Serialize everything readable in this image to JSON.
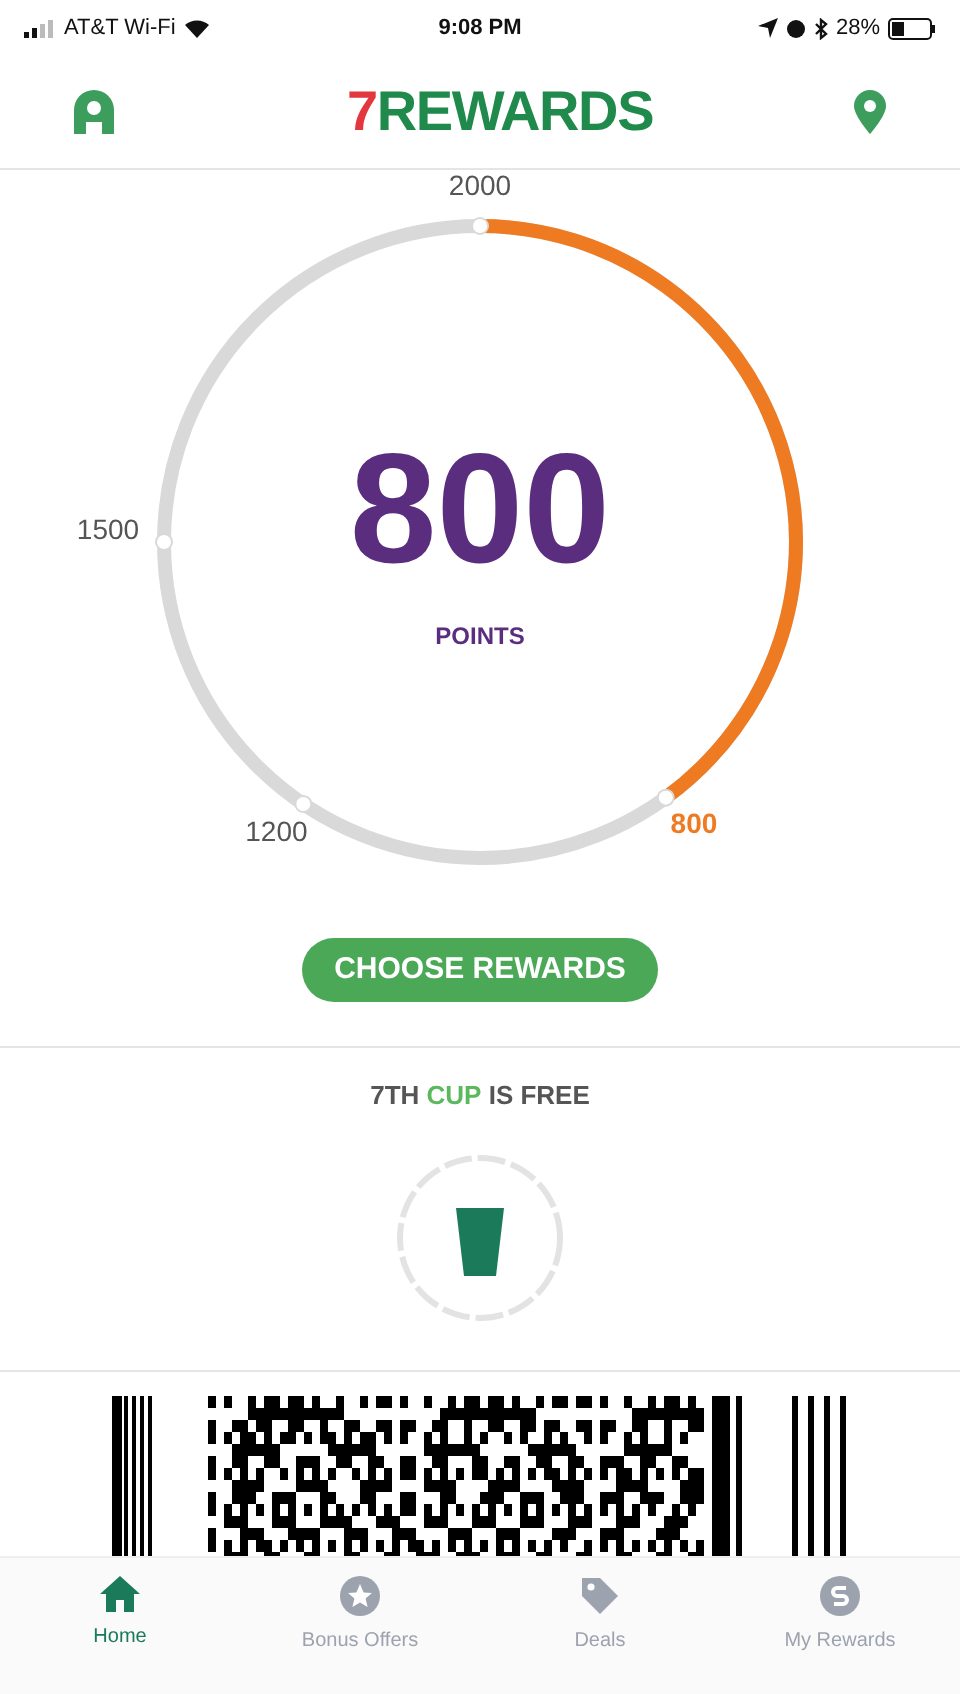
{
  "status_bar": {
    "carrier": "AT&T Wi-Fi",
    "time": "9:08 PM",
    "battery": "28%"
  },
  "header": {
    "logo_digit": "7",
    "logo_word": "REWARDS"
  },
  "points": {
    "value": "800",
    "label": "POINTS",
    "ticks": [
      {
        "label": "2000",
        "kind": "top"
      },
      {
        "label": "1500",
        "kind": "left"
      },
      {
        "label": "1200",
        "kind": "bottom-left"
      },
      {
        "label": "800",
        "kind": "current"
      }
    ]
  },
  "choose_button": "CHOOSE REWARDS",
  "cup_offer": {
    "text": "7TH **CUP** IS FREE"
  },
  "tabs": [
    {
      "label": "Home",
      "selected": true
    },
    {
      "label": "Bonus Offers",
      "selected": false
    },
    {
      "label": "Deals",
      "selected": false
    },
    {
      "label": "My Rewards",
      "selected": false
    }
  ]
}
